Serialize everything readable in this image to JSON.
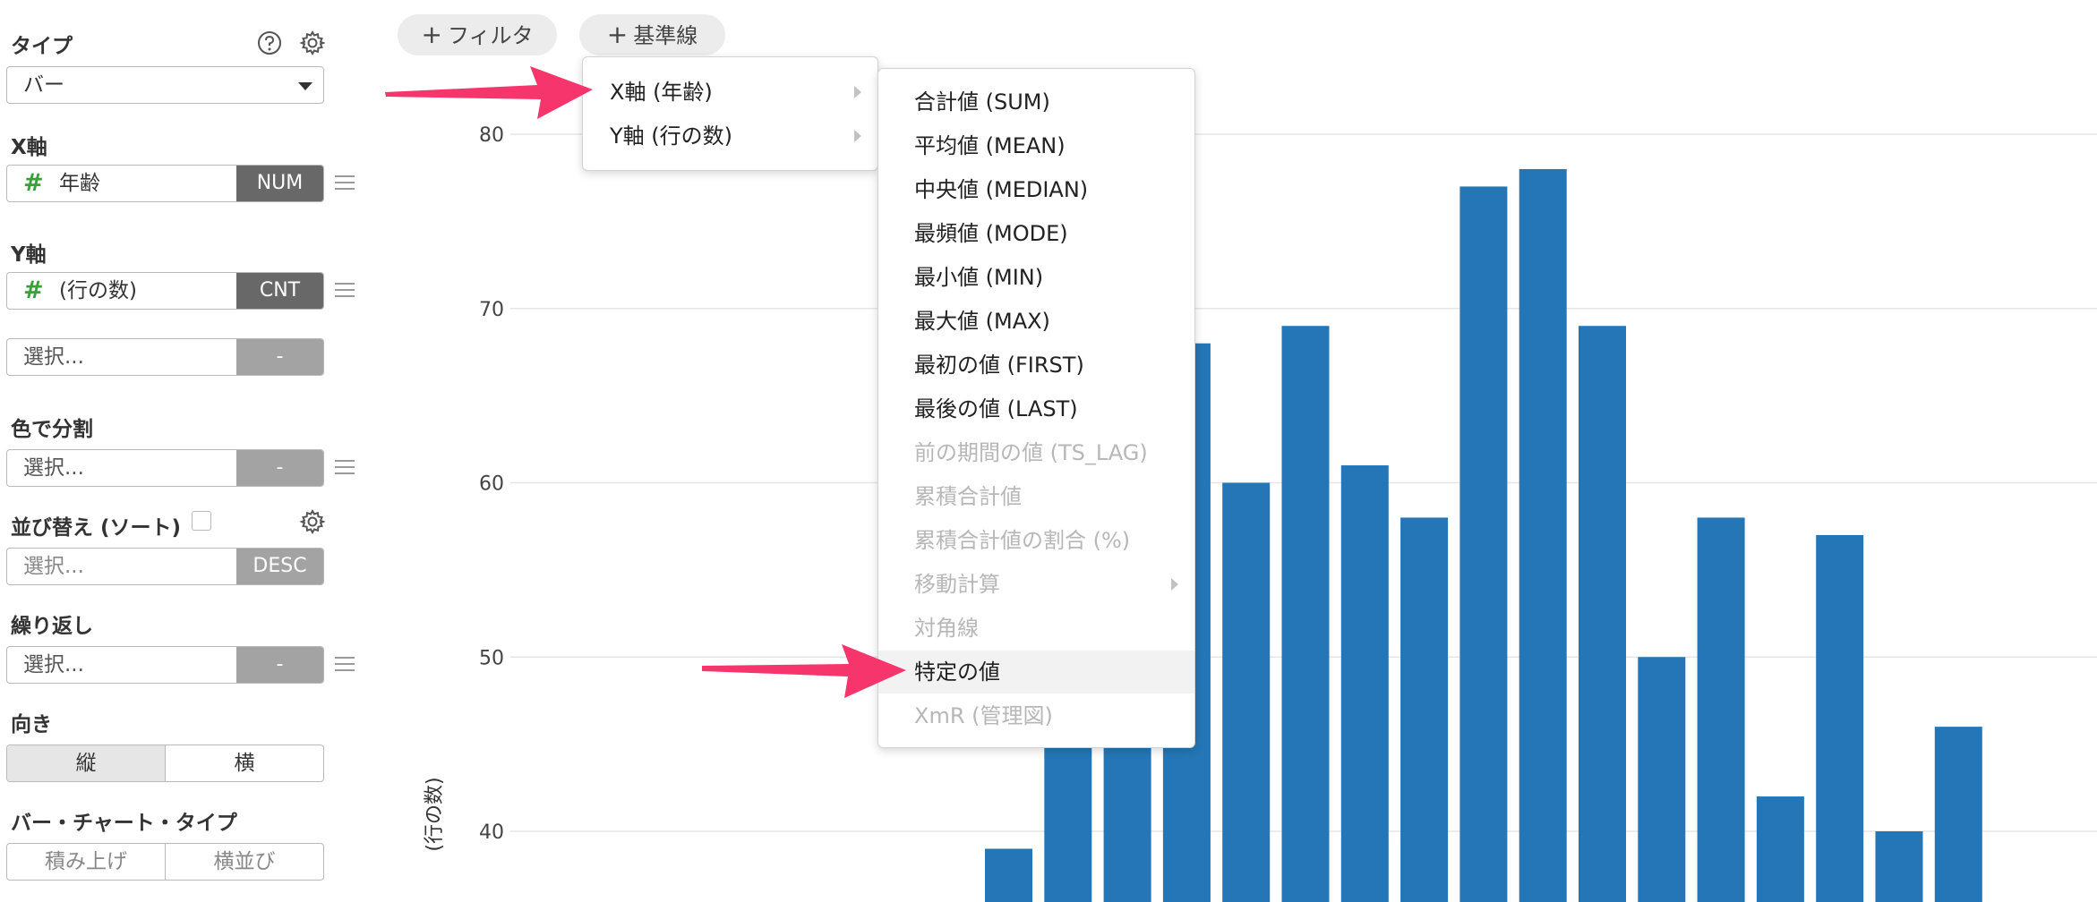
{
  "sidebar": {
    "type_label": "タイプ",
    "type_value": "バー",
    "x_label": "X軸",
    "x_field": "年齢",
    "x_tag": "NUM",
    "y_label": "Y軸",
    "y_field": "(行の数)",
    "y_tag": "CNT",
    "y2_placeholder": "選択...",
    "y2_tag": "-",
    "color_label": "色で分割",
    "color_placeholder": "選択...",
    "color_tag": "-",
    "sort_label": "並び替え (ソート)",
    "sort_placeholder": "選択...",
    "sort_tag": "DESC",
    "repeat_label": "繰り返し",
    "repeat_placeholder": "選択...",
    "repeat_tag": "-",
    "direction_label": "向き",
    "direction_options": [
      "縦",
      "横"
    ],
    "bar_type_label": "バー・チャート・タイプ",
    "bar_type_options": [
      "積み上げ",
      "横並び"
    ]
  },
  "toolbar": {
    "filter_label": "フィルタ",
    "refline_label": "基準線"
  },
  "menu_axis": {
    "items": [
      "X軸 (年齢)",
      "Y軸 (行の数)"
    ]
  },
  "menu_aggregate": {
    "items": [
      {
        "label": "合計値 (SUM)",
        "enabled": true
      },
      {
        "label": "平均値 (MEAN)",
        "enabled": true
      },
      {
        "label": "中央値 (MEDIAN)",
        "enabled": true
      },
      {
        "label": "最頻値 (MODE)",
        "enabled": true
      },
      {
        "label": "最小値 (MIN)",
        "enabled": true
      },
      {
        "label": "最大値 (MAX)",
        "enabled": true
      },
      {
        "label": "最初の値 (FIRST)",
        "enabled": true
      },
      {
        "label": "最後の値 (LAST)",
        "enabled": true
      },
      {
        "label": "前の期間の値 (TS_LAG)",
        "enabled": false
      },
      {
        "label": "累積合計値",
        "enabled": false
      },
      {
        "label": "累積合計値の割合 (%)",
        "enabled": false
      },
      {
        "label": "移動計算",
        "enabled": false,
        "submenu": true
      },
      {
        "label": "対角線",
        "enabled": false
      },
      {
        "label": "特定の値",
        "enabled": true,
        "highlighted": true
      },
      {
        "label": "XmR (管理図)",
        "enabled": false
      }
    ]
  },
  "chart_data": {
    "type": "bar",
    "ylabel": "(行の数)",
    "y_ticks": [
      40,
      50,
      60,
      70,
      80
    ],
    "ylim": [
      36,
      84
    ],
    "grid": true,
    "color": "#2476b6",
    "values": [
      39,
      47,
      52,
      68,
      60,
      69,
      61,
      58,
      77,
      78,
      69,
      50,
      58,
      42,
      57,
      40,
      46
    ]
  },
  "colors": {
    "accent_arrow": "#f5356b",
    "bar": "#2476b6",
    "tag_dark": "#686868",
    "tag_light": "#a3a3a3",
    "hash_green": "#3aa03a"
  }
}
